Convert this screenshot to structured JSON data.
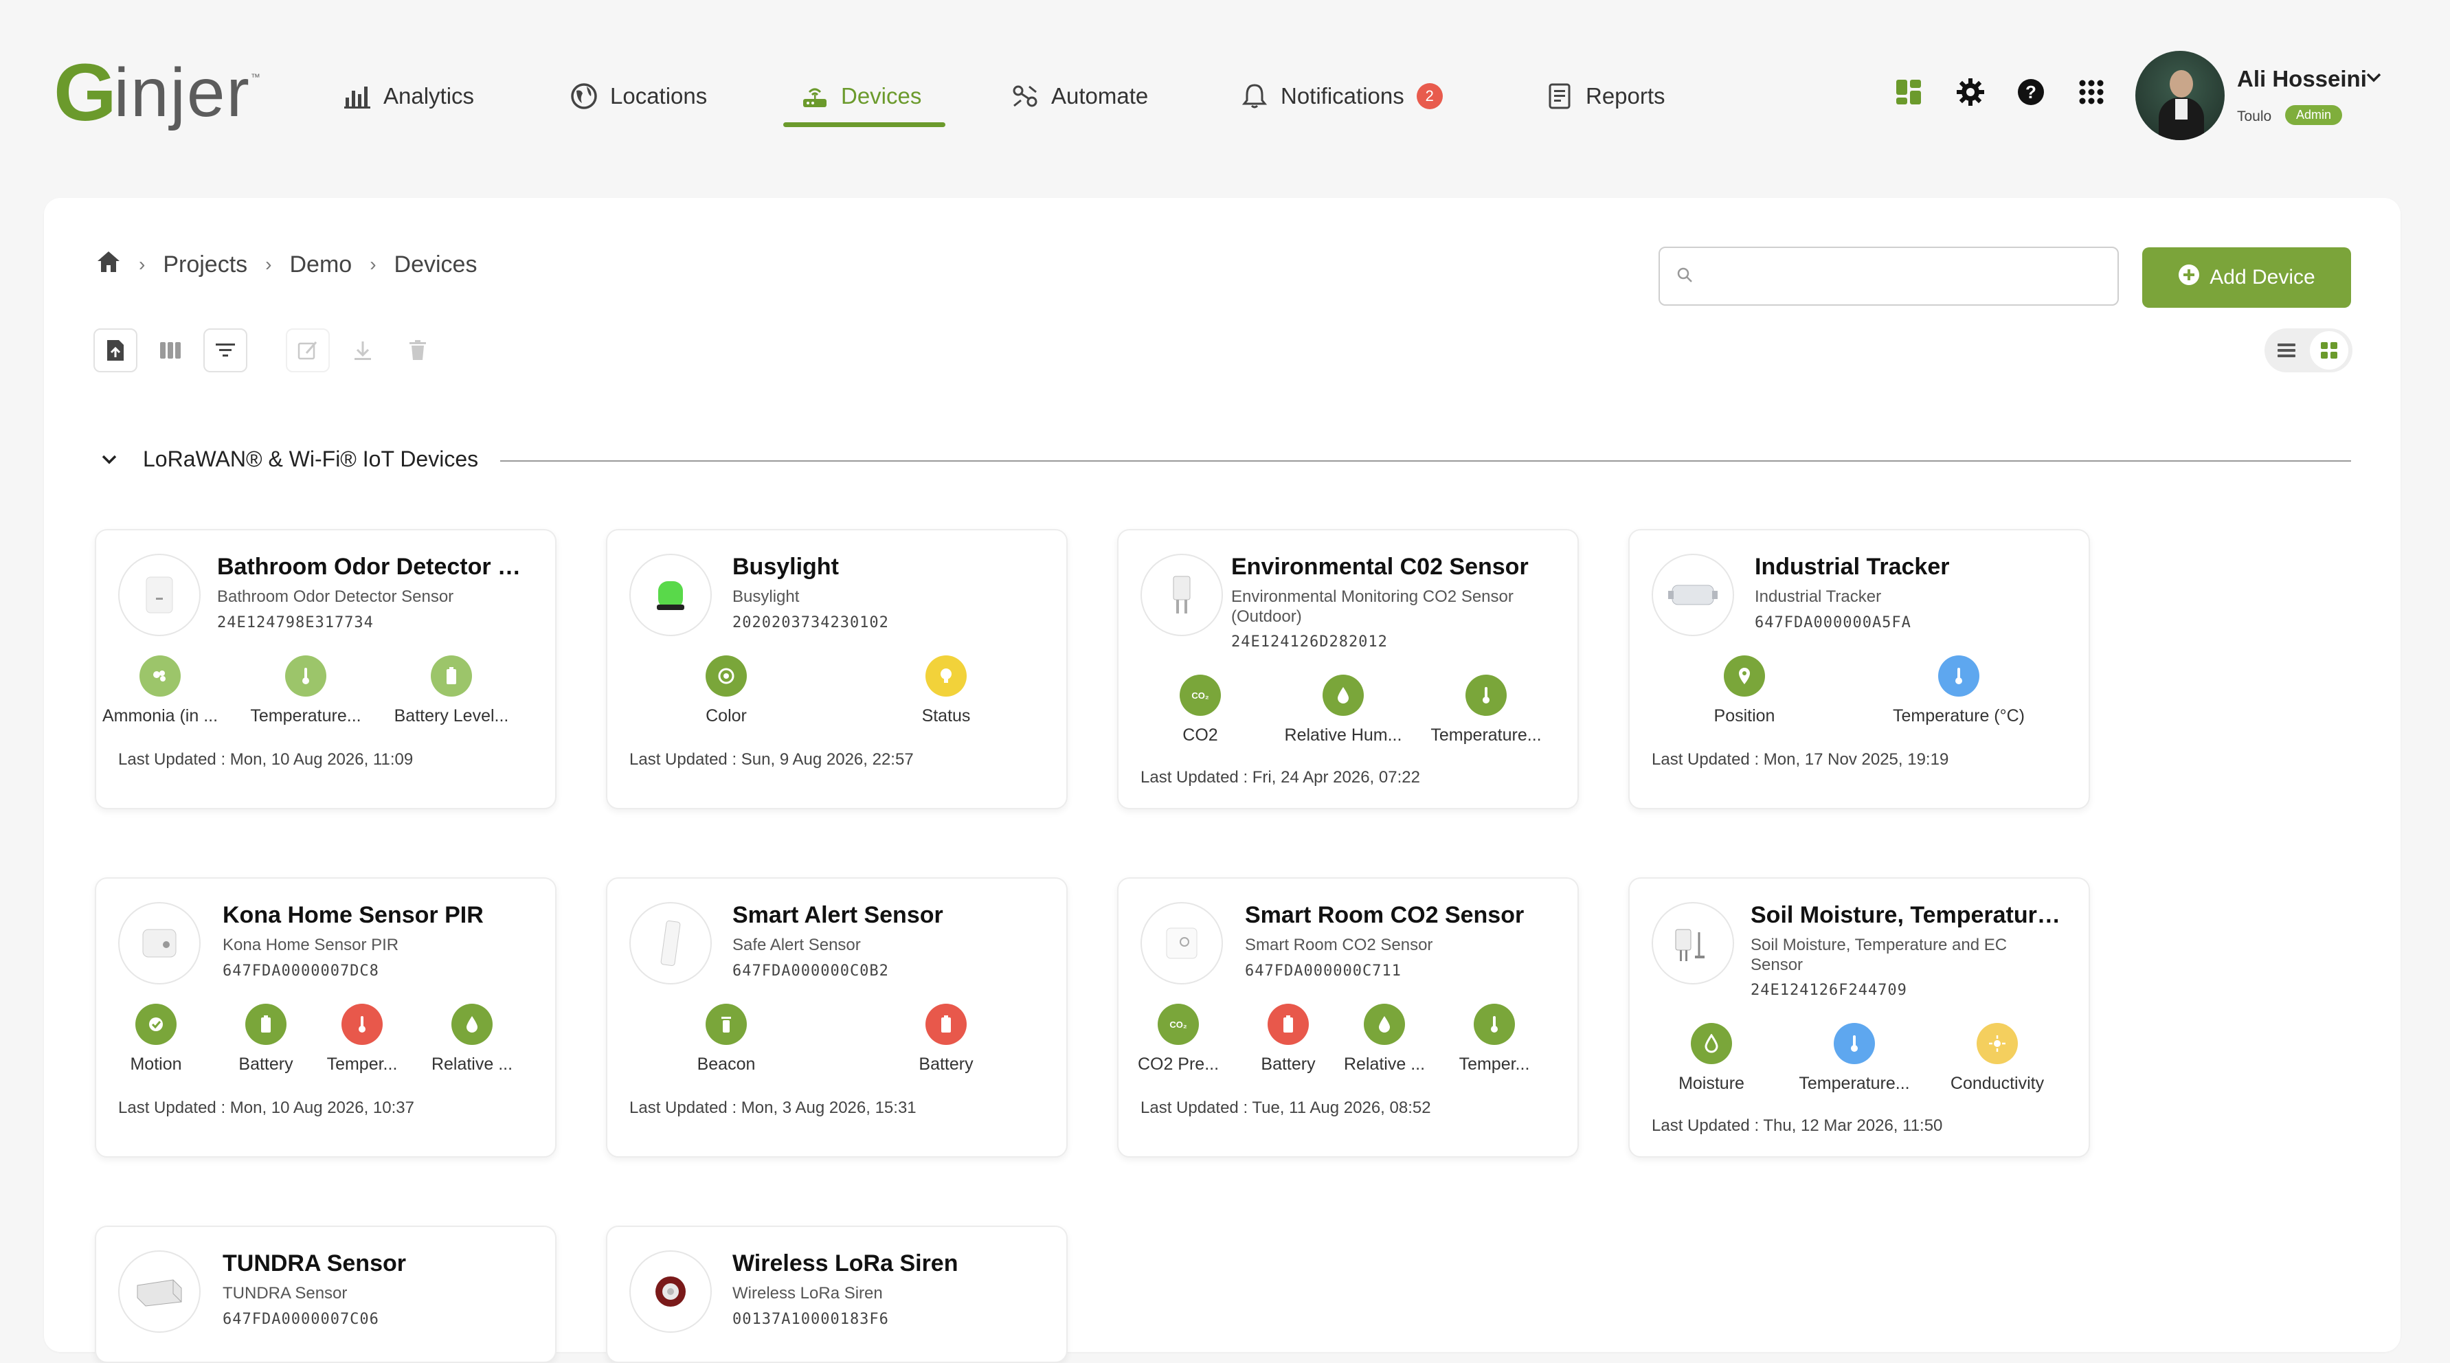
{
  "brand": {
    "logo_text_g": "G",
    "logo_text_rest": "injer",
    "tm": "™"
  },
  "nav": {
    "analytics": "Analytics",
    "locations": "Locations",
    "devices": "Devices",
    "automate": "Automate",
    "notifications": "Notifications",
    "notifications_count": "2",
    "reports": "Reports"
  },
  "user": {
    "name": "Ali Hosseini",
    "org": "Toulo",
    "role": "Admin"
  },
  "breadcrumb": [
    "Projects",
    "Demo",
    "Devices"
  ],
  "search": {
    "placeholder": "",
    "value": ""
  },
  "add_device": "Add Device",
  "section": {
    "title": "LoRaWAN® & Wi-Fi® IoT Devices"
  },
  "colors": {
    "accent": "#6b9a2c",
    "button": "#7ba43a",
    "alert": "#e8584b"
  },
  "devices": [
    {
      "title": "Bathroom Odor Detector Se...",
      "subtitle": "Bathroom Odor Detector Sensor",
      "id": "24E124798E317734",
      "metrics": [
        {
          "label": "Ammonia (in ...",
          "color": "lightgreen",
          "icon": "gas-icon"
        },
        {
          "label": "Temperature...",
          "color": "lightgreen",
          "icon": "thermometer-icon"
        },
        {
          "label": "Battery Level...",
          "color": "lightgreen",
          "icon": "battery-icon"
        }
      ],
      "updated": "Last Updated : Mon, 10 Aug 2026, 11:09"
    },
    {
      "title": "Busylight",
      "subtitle": "Busylight",
      "id": "2020203734230102",
      "metrics": [
        {
          "label": "Color",
          "color": "green",
          "icon": "color-icon"
        },
        {
          "label": "Status",
          "color": "yellow",
          "icon": "status-icon"
        }
      ],
      "updated": "Last Updated : Sun, 9 Aug 2026, 22:57"
    },
    {
      "title": "Environmental C02 Sensor",
      "subtitle": "Environmental Monitoring CO2 Sensor (Outdoor)",
      "id": "24E124126D282012",
      "metrics": [
        {
          "label": "CO2",
          "color": "green",
          "icon": "co2-icon"
        },
        {
          "label": "Relative Hum...",
          "color": "green",
          "icon": "humidity-icon"
        },
        {
          "label": "Temperature...",
          "color": "green",
          "icon": "thermometer-icon"
        }
      ],
      "updated": "Last Updated : Fri, 24 Apr 2026, 07:22"
    },
    {
      "title": "Industrial Tracker",
      "subtitle": "Industrial Tracker",
      "id": "647FDA000000A5FA",
      "metrics": [
        {
          "label": "Position",
          "color": "green",
          "icon": "location-icon"
        },
        {
          "label": "Temperature (°C)",
          "color": "blue",
          "icon": "thermometer-icon"
        }
      ],
      "updated": "Last Updated : Mon, 17 Nov 2025, 19:19"
    },
    {
      "title": "Kona Home Sensor PIR",
      "subtitle": "Kona Home Sensor PIR",
      "id": "647FDA0000007DC8",
      "metrics": [
        {
          "label": "Motion",
          "color": "green",
          "icon": "motion-icon"
        },
        {
          "label": "Battery",
          "color": "green",
          "icon": "battery-icon"
        },
        {
          "label": "Temper...",
          "color": "red",
          "icon": "thermometer-icon"
        },
        {
          "label": "Relative ...",
          "color": "green",
          "icon": "humidity-icon"
        }
      ],
      "updated": "Last Updated : Mon, 10 Aug 2026, 10:37"
    },
    {
      "title": "Smart Alert Sensor",
      "subtitle": "Safe Alert Sensor",
      "id": "647FDA000000C0B2",
      "metrics": [
        {
          "label": "Beacon",
          "color": "green",
          "icon": "beacon-icon"
        },
        {
          "label": "Battery",
          "color": "red",
          "icon": "battery-icon"
        }
      ],
      "updated": "Last Updated : Mon, 3 Aug 2026, 15:31"
    },
    {
      "title": "Smart Room CO2 Sensor",
      "subtitle": "Smart Room CO2 Sensor",
      "id": "647FDA000000C711",
      "metrics": [
        {
          "label": "CO2 Pre...",
          "color": "green",
          "icon": "co2-icon"
        },
        {
          "label": "Battery",
          "color": "red",
          "icon": "battery-icon"
        },
        {
          "label": "Relative ...",
          "color": "green",
          "icon": "humidity-icon"
        },
        {
          "label": "Temper...",
          "color": "green",
          "icon": "thermometer-icon"
        }
      ],
      "updated": "Last Updated : Tue, 11 Aug 2026, 08:52"
    },
    {
      "title": "Soil Moisture, Temperature ...",
      "subtitle": "Soil Moisture, Temperature and EC Sensor",
      "id": "24E124126F244709",
      "metrics": [
        {
          "label": "Moisture",
          "color": "green",
          "icon": "moisture-icon"
        },
        {
          "label": "Temperature...",
          "color": "blue",
          "icon": "thermometer-icon"
        },
        {
          "label": "Conductivity",
          "color": "lightyellow",
          "icon": "conductivity-icon"
        }
      ],
      "updated": "Last Updated : Thu, 12 Mar 2026, 11:50"
    },
    {
      "title": "TUNDRA Sensor",
      "subtitle": "TUNDRA Sensor",
      "id": "647FDA0000007C06",
      "metrics": [],
      "updated": ""
    },
    {
      "title": "Wireless LoRa Siren",
      "subtitle": "Wireless LoRa Siren",
      "id": "00137A10000183F6",
      "metrics": [],
      "updated": ""
    }
  ]
}
